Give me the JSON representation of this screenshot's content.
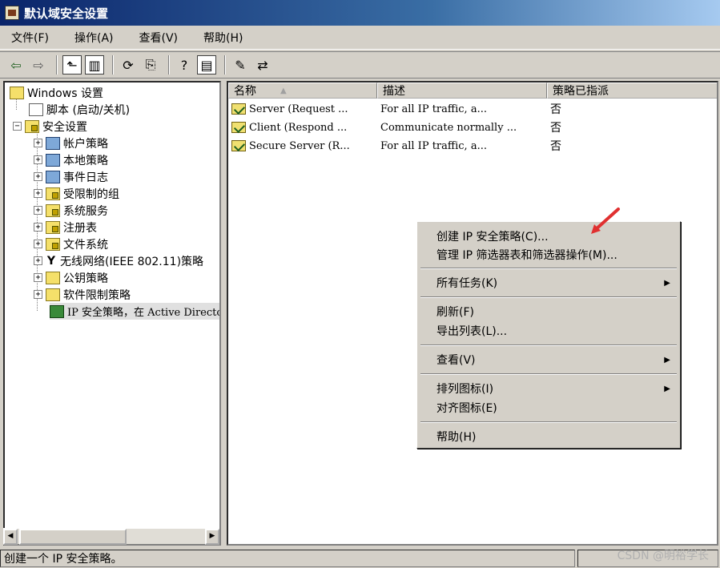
{
  "window": {
    "title": "默认域安全设置"
  },
  "menubar": [
    "文件(F)",
    "操作(A)",
    "查看(V)",
    "帮助(H)"
  ],
  "tree": {
    "root": "Windows 设置",
    "items": [
      {
        "label": "脚本 (启动/关机)",
        "icon": "script-icon"
      },
      {
        "label": "安全设置",
        "icon": "security-settings-icon"
      },
      {
        "label": "帐户策略",
        "icon": "account-policy-icon"
      },
      {
        "label": "本地策略",
        "icon": "local-policy-icon"
      },
      {
        "label": "事件日志",
        "icon": "event-log-icon"
      },
      {
        "label": "受限制的组",
        "icon": "folder-lock-icon"
      },
      {
        "label": "系统服务",
        "icon": "folder-lock-icon"
      },
      {
        "label": "注册表",
        "icon": "folder-lock-icon"
      },
      {
        "label": "文件系统",
        "icon": "folder-lock-icon"
      },
      {
        "label": "无线网络(IEEE 802.11)策略",
        "icon": "wireless-icon"
      },
      {
        "label": "公钥策略",
        "icon": "folder-icon"
      },
      {
        "label": "软件限制策略",
        "icon": "folder-icon"
      },
      {
        "label": "IP 安全策略，在 Active Directory",
        "icon": "ip-security-icon"
      }
    ]
  },
  "list": {
    "columns": [
      "名称",
      "描述",
      "策略已指派"
    ],
    "rows": [
      {
        "name": "Server (Request ...",
        "desc": "For all IP traffic, a...",
        "assigned": "否"
      },
      {
        "name": "Client (Respond ...",
        "desc": "Communicate normally ...",
        "assigned": "否"
      },
      {
        "name": "Secure Server (R...",
        "desc": "For all IP traffic, a...",
        "assigned": "否"
      }
    ]
  },
  "context_menu": {
    "create": "创建 IP 安全策略(C)...",
    "manage": "管理 IP 筛选器表和筛选器操作(M)...",
    "all_tasks": "所有任务(K)",
    "refresh": "刷新(F)",
    "export": "导出列表(L)...",
    "view": "查看(V)",
    "arrange": "排列图标(I)",
    "align": "对齐图标(E)",
    "help": "帮助(H)"
  },
  "status": {
    "text": "创建一个 IP 安全策略。"
  },
  "watermark": "CSDN @明裕学长",
  "colors": {
    "title_start": "#0a246a",
    "title_end": "#a6caf0",
    "arrow": "#e03030"
  }
}
